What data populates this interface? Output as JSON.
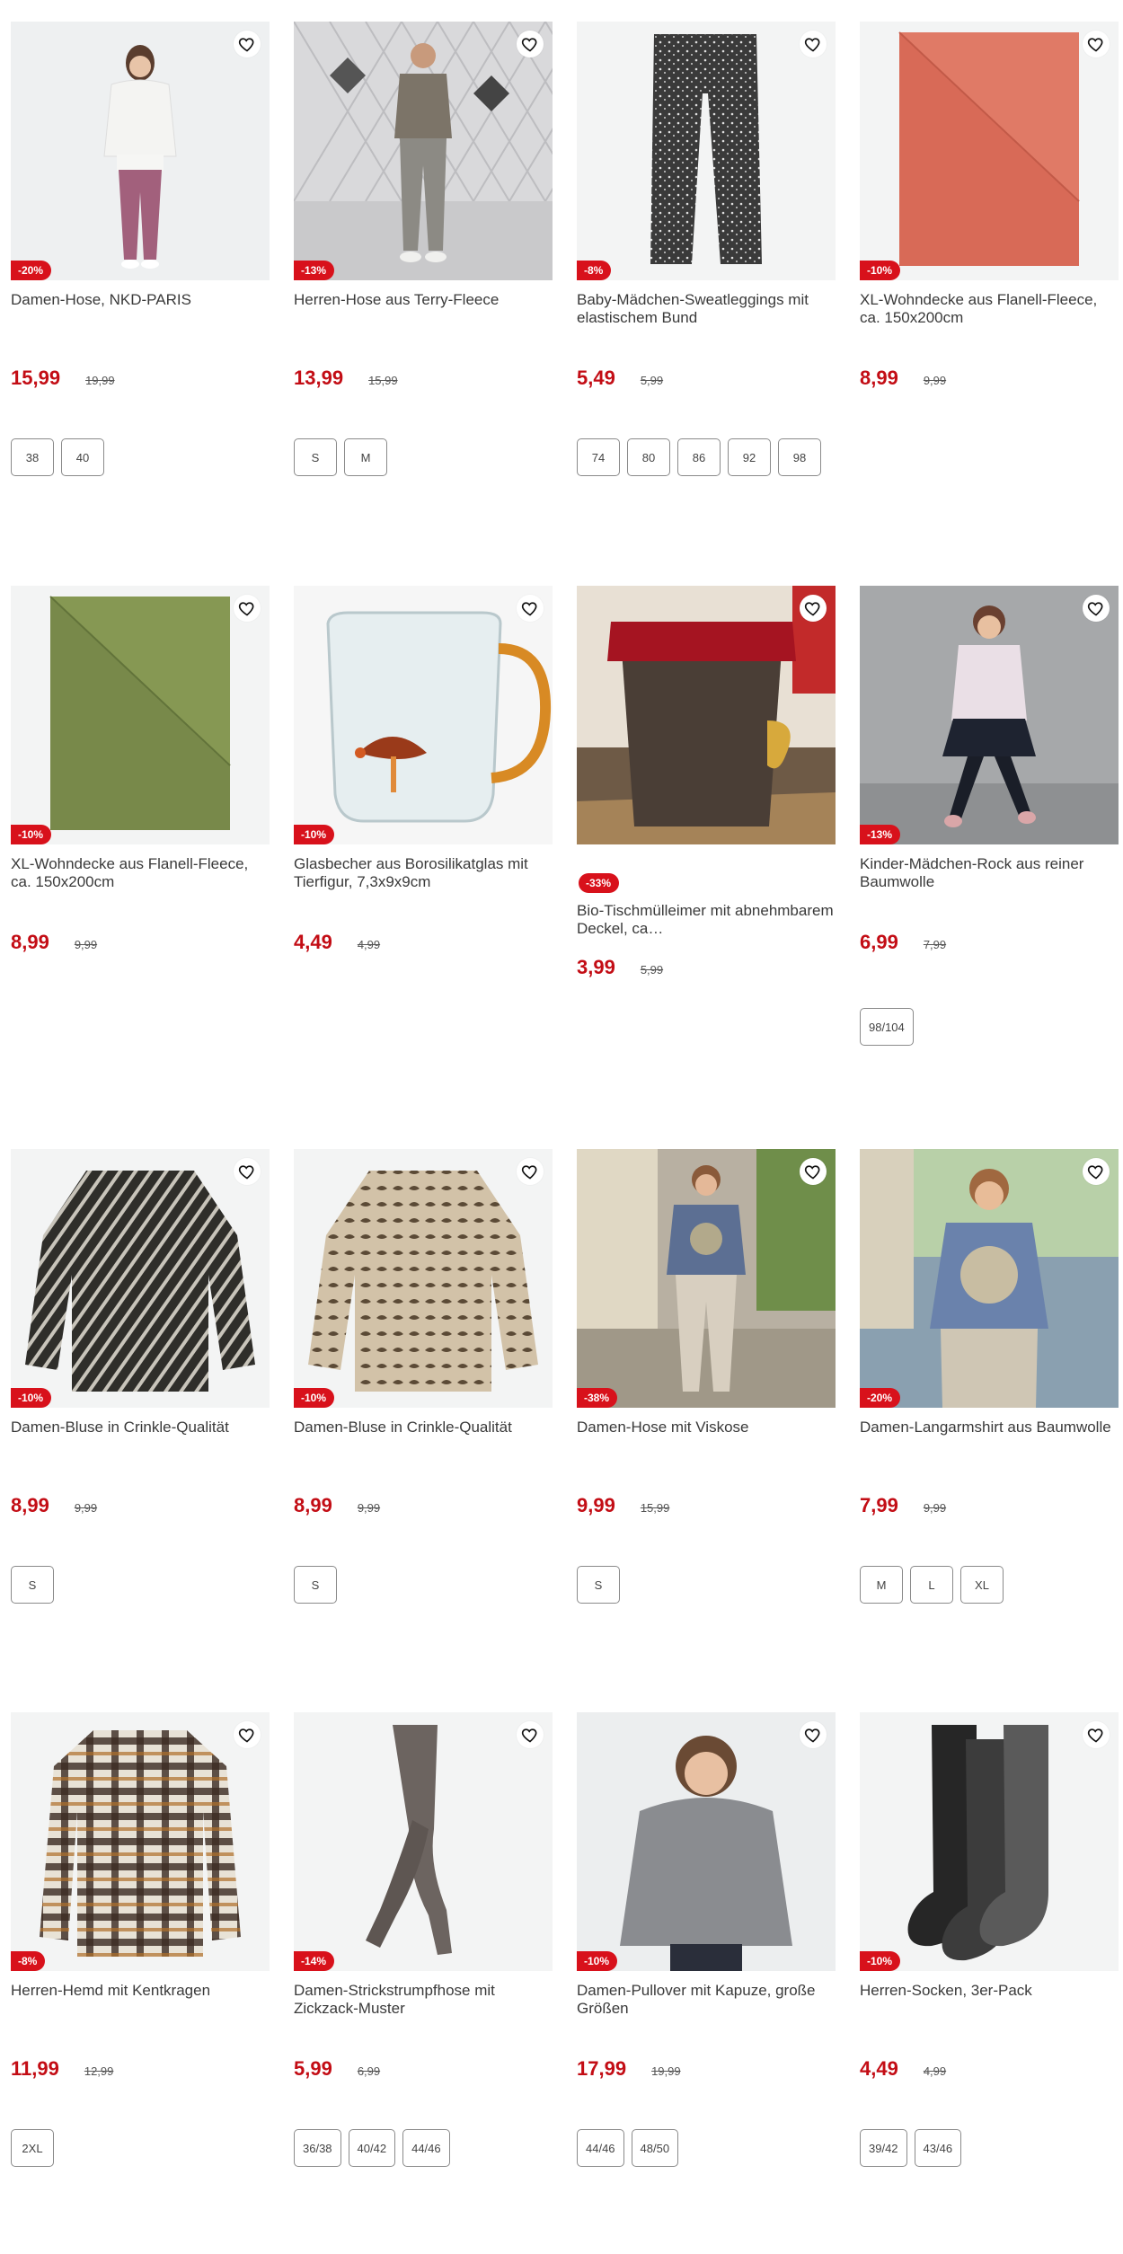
{
  "colors": {
    "accent": "#c30d15",
    "badge": "#d8111b"
  },
  "products": [
    {
      "title": "Damen-Hose, NKD-PARIS",
      "price": "15,99",
      "old_price": "19,99",
      "discount": "-20%",
      "sizes": [
        "38",
        "40"
      ],
      "image": "woman-white-cardigan-pink-trousers"
    },
    {
      "title": "Herren-Hose aus Terry-Fleece",
      "price": "13,99",
      "old_price": "15,99",
      "discount": "-13%",
      "sizes": [
        "S",
        "M"
      ],
      "image": "man-grey-outfit"
    },
    {
      "title": "Baby-Mädchen-Sweatleggings mit elastischem Bund",
      "price": "5,49",
      "old_price": "5,99",
      "discount": "-8%",
      "sizes": [
        "74",
        "80",
        "86",
        "92",
        "98"
      ],
      "image": "dotted-leggings"
    },
    {
      "title": "XL-Wohndecke aus Flanell-Fleece, ca. 150x200cm",
      "price": "8,99",
      "old_price": "9,99",
      "discount": "-10%",
      "sizes": [],
      "image": "red-blanket"
    },
    {
      "title": "XL-Wohndecke aus Flanell-Fleece, ca. 150x200cm",
      "price": "8,99",
      "old_price": "9,99",
      "discount": "-10%",
      "sizes": [],
      "image": "green-blanket"
    },
    {
      "title": "Glasbecher aus Borosilikatglas mit Tierfigur, 7,3x9x9cm",
      "price": "4,49",
      "old_price": "4,99",
      "discount": "-10%",
      "sizes": [],
      "image": "glass-mug-hedgehog"
    },
    {
      "title": "Bio-Tischmülleimer mit abnehmbarem Deckel, ca…",
      "price": "3,99",
      "old_price": "5,99",
      "discount": "-33%",
      "sizes": [],
      "image": "compost-bin"
    },
    {
      "title": "Kinder-Mädchen-Rock aus reiner Baumwolle",
      "price": "6,99",
      "old_price": "7,99",
      "discount": "-13%",
      "sizes": [
        "98/104"
      ],
      "image": "girl-skirt"
    },
    {
      "title": "Damen-Bluse in Crinkle-Qualität",
      "price": "8,99",
      "old_price": "9,99",
      "discount": "-10%",
      "sizes": [
        "S"
      ],
      "image": "dark-print-blouse"
    },
    {
      "title": "Damen-Bluse in Crinkle-Qualität",
      "price": "8,99",
      "old_price": "9,99",
      "discount": "-10%",
      "sizes": [
        "S"
      ],
      "image": "beige-print-blouse"
    },
    {
      "title": "Damen-Hose mit Viskose",
      "price": "9,99",
      "old_price": "15,99",
      "discount": "-38%",
      "sizes": [
        "S"
      ],
      "image": "woman-patterned-trousers"
    },
    {
      "title": "Damen-Langarmshirt aus Baumwolle",
      "price": "7,99",
      "old_price": "9,99",
      "discount": "-20%",
      "sizes": [
        "M",
        "L",
        "XL"
      ],
      "image": "woman-blue-shirt"
    },
    {
      "title": "Herren-Hemd mit Kentkragen",
      "price": "11,99",
      "old_price": "12,99",
      "discount": "-8%",
      "sizes": [
        "2XL"
      ],
      "image": "plaid-shirt"
    },
    {
      "title": "Damen-Strickstrumpfhose mit Zickzack-Muster",
      "price": "5,99",
      "old_price": "6,99",
      "discount": "-14%",
      "sizes": [
        "36/38",
        "40/42",
        "44/46"
      ],
      "image": "tights-legs"
    },
    {
      "title": "Damen-Pullover mit Kapuze, große Größen",
      "price": "17,99",
      "old_price": "19,99",
      "discount": "-10%",
      "sizes": [
        "44/46",
        "48/50"
      ],
      "image": "woman-grey-hoodie"
    },
    {
      "title": "Herren-Socken, 3er-Pack",
      "price": "4,49",
      "old_price": "4,99",
      "discount": "-10%",
      "sizes": [
        "39/42",
        "43/46"
      ],
      "image": "three-socks"
    }
  ]
}
